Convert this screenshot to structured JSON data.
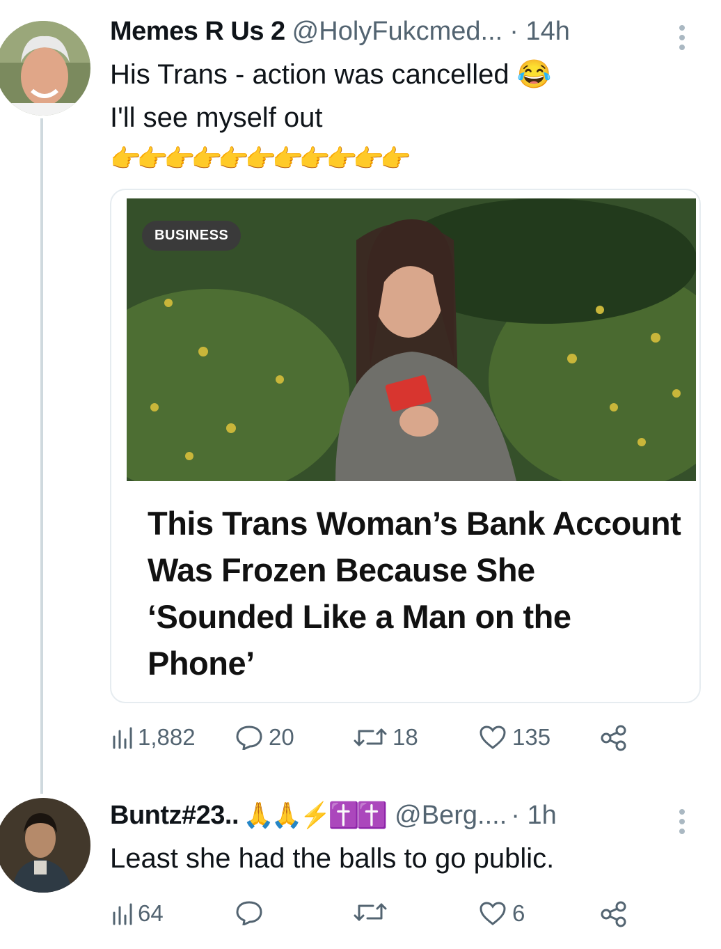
{
  "tweet1": {
    "author_name": "Memes R Us 2",
    "handle": "@HolyFukcmed...",
    "time": "· 14h",
    "text_line1": "His Trans - action was cancelled",
    "text_emoji": "😂",
    "text_line2": "I'll see myself out",
    "pointing_emojis": "👉👉👉👉👉👉👉👉👉👉👉",
    "card": {
      "badge": "BUSINESS",
      "headline": "This Trans Woman’s Bank Account Was Frozen Because She ‘Sounded Like a Man on the Phone’"
    },
    "stats": {
      "views": "1,882",
      "replies": "20",
      "retweets": "18",
      "likes": "135"
    }
  },
  "tweet2": {
    "author_name": "Buntz#23..",
    "name_emojis": "🙏🙏⚡✝️✝️",
    "handle": "@Berg....",
    "time": "· 1h",
    "text": "Least she had the balls to go public.",
    "stats": {
      "views": "64",
      "replies": "",
      "retweets": "",
      "likes": "6"
    }
  },
  "colors": {
    "text": "#0f1419",
    "secondary": "#536471",
    "thread_line": "#cfd9de",
    "border": "#e6ecf0"
  },
  "icons": [
    "views-icon",
    "reply-icon",
    "retweet-icon",
    "like-icon",
    "share-icon",
    "more-icon"
  ]
}
